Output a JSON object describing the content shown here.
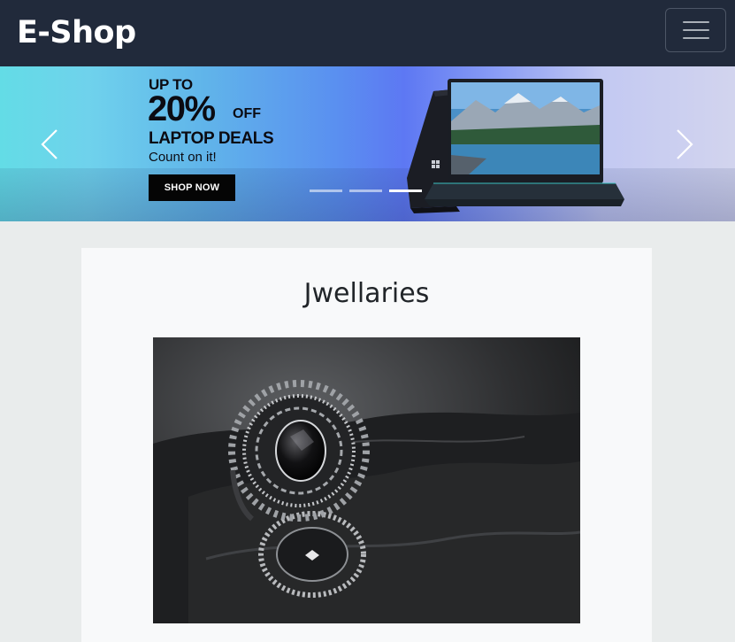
{
  "navbar": {
    "brand": "E-Shop",
    "toggler_icon": "hamburger-menu-icon"
  },
  "carousel": {
    "slide": {
      "promo_up_to": "UP TO",
      "promo_percent": "20%",
      "promo_off": "OFF",
      "promo_title": "LAPTOP DEALS",
      "promo_subtitle": "Count on it!",
      "cta_label": "SHOP NOW"
    },
    "controls": {
      "prev_icon": "chevron-left-icon",
      "next_icon": "chevron-right-icon"
    },
    "indicators": {
      "count": 3,
      "active_index": 2
    }
  },
  "category_card": {
    "title": "Jwellaries",
    "image_subject": "black and silver ring with black gemstone"
  },
  "colors": {
    "navbar_bg": "#212a3b",
    "page_bg": "#e9ecec",
    "card_bg": "#f8f9fa"
  }
}
